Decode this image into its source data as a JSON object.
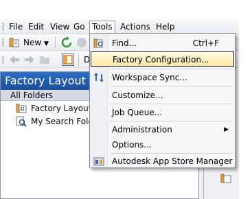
{
  "menubar": {
    "items": [
      {
        "label": "File"
      },
      {
        "label": "Edit"
      },
      {
        "label": "View"
      },
      {
        "label": "Go"
      },
      {
        "label": "Tools"
      },
      {
        "label": "Actions"
      },
      {
        "label": "Help"
      }
    ]
  },
  "toolbar": {
    "new_label": "New",
    "partial_text": "D"
  },
  "left_pane": {
    "title": "Factory Layout",
    "folders_header": "All Folders",
    "tree": [
      {
        "label": "Factory Layout",
        "icon": "factory-layout-icon"
      },
      {
        "label": "My Search Folde",
        "icon": "search-folder-icon"
      }
    ]
  },
  "tools_menu": {
    "items": [
      {
        "label": "Find...",
        "shortcut": "Ctrl+F",
        "icon": "find-icon"
      },
      {
        "label": "Factory Configuration...",
        "highlighted": true
      },
      {
        "label": "Workspace Sync...",
        "icon": "workspace-sync-icon"
      },
      {
        "label": "Customize..."
      },
      {
        "label": "Job Queue..."
      },
      {
        "label": "Administration",
        "submenu": true
      },
      {
        "label": "Options..."
      },
      {
        "label": "Autodesk App Store Manager",
        "icon": "app-store-icon"
      }
    ]
  },
  "colors": {
    "header_blue": "#1c4f9c",
    "highlight": "#fde9a6"
  }
}
